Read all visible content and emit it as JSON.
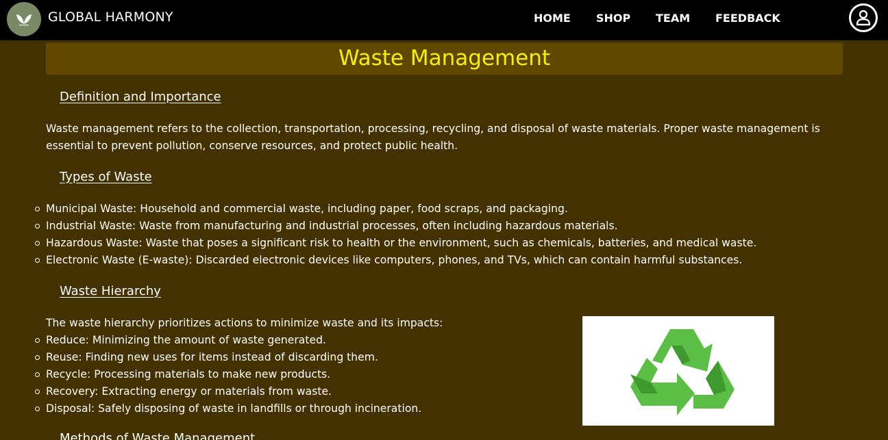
{
  "nav": {
    "brand": "GLOBAL HARMONY",
    "logo_icon": "leaf-logo-icon",
    "links": [
      "HOME",
      "SHOP",
      "TEAM",
      "FEEDBACK"
    ],
    "user_icon": "user-account-icon"
  },
  "page": {
    "title": "Waste Management",
    "sections": {
      "definition": {
        "heading": "Definition and Importance",
        "text": "Waste management refers to the collection, transportation, processing, recycling, and disposal of waste materials. Proper waste management is essential to prevent pollution, conserve resources, and protect public health."
      },
      "types": {
        "heading": "Types of Waste",
        "items": [
          "Municipal Waste: Household and commercial waste, including paper, food scraps, and packaging.",
          "Industrial Waste: Waste from manufacturing and industrial processes, often including hazardous materials.",
          "Hazardous Waste: Waste that poses a significant risk to health or the environment, such as chemicals, batteries, and medical waste.",
          "Electronic Waste (E-waste): Discarded electronic devices like computers, phones, and TVs, which can contain harmful substances."
        ]
      },
      "hierarchy": {
        "heading": "Waste Hierarchy",
        "intro": "The waste hierarchy prioritizes actions to minimize waste and its impacts:",
        "items": [
          "Reduce: Minimizing the amount of waste generated.",
          "Reuse: Finding new uses for items instead of discarding them.",
          "Recycle: Processing materials to make new products.",
          "Recovery: Extracting energy or materials from waste.",
          "Disposal: Safely disposing of waste in landfills or through incineration."
        ],
        "image_icon": "recycle-icon"
      },
      "methods": {
        "heading": "Methods of Waste Management"
      }
    }
  },
  "colors": {
    "background": "#443100",
    "navbar": "#000000",
    "title_banner": "#614800",
    "title_text": "#f2f200",
    "recycle_green_light": "#5cbf45",
    "recycle_green_dark": "#3f9a2e"
  }
}
